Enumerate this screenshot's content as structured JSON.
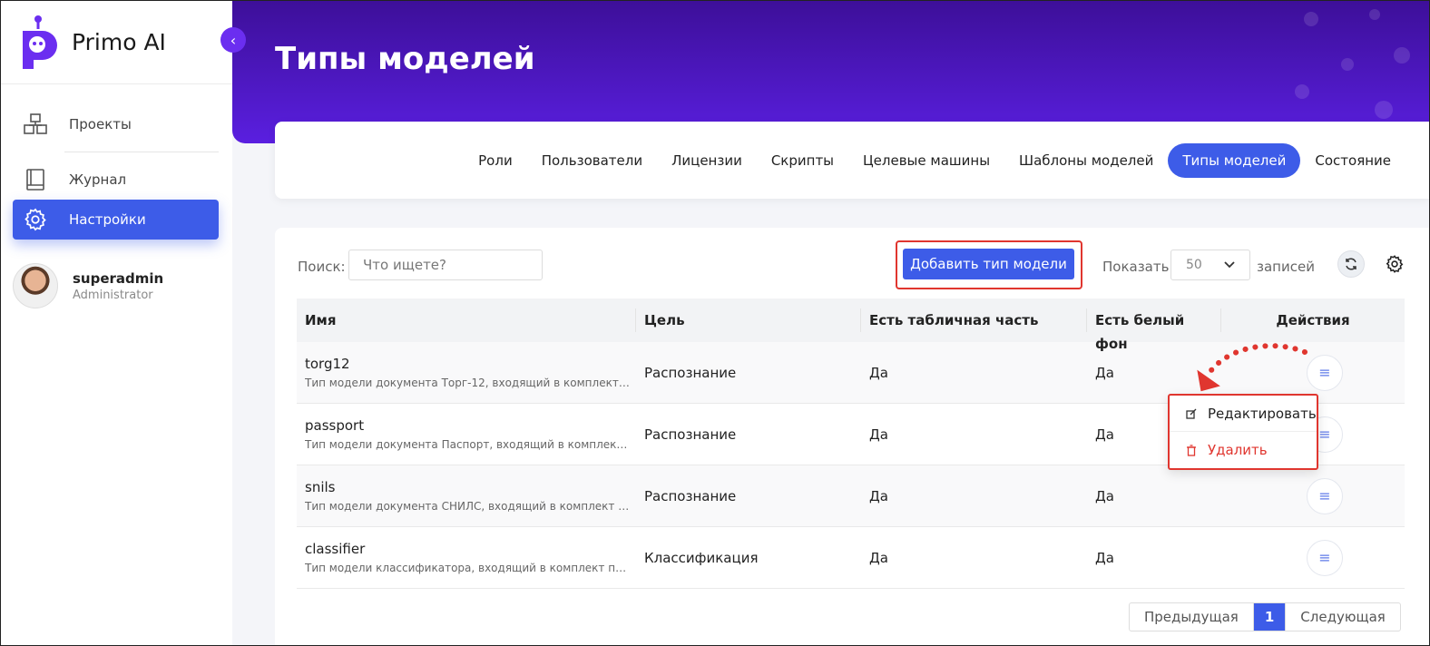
{
  "app": {
    "name": "Primo AI"
  },
  "header": {
    "title": "Типы моделей"
  },
  "sidebar": {
    "items": [
      {
        "label": "Проекты",
        "icon": "projects-icon"
      },
      {
        "label": "Журнал",
        "icon": "journal-icon"
      },
      {
        "label": "Настройки",
        "icon": "settings-icon",
        "active": true
      }
    ],
    "user": {
      "name": "superadmin",
      "role": "Administrator"
    }
  },
  "tabs": [
    "Роли",
    "Пользователи",
    "Лицензии",
    "Скрипты",
    "Целевые машины",
    "Шаблоны моделей",
    "Типы моделей",
    "Состояние"
  ],
  "active_tab": "Типы моделей",
  "toolbar": {
    "search_label": "Поиск:",
    "search_placeholder": "Что ищете?",
    "add_button": "Добавить тип модели",
    "show_label": "Показать",
    "page_size": "50",
    "records_label": "записей"
  },
  "table": {
    "columns": [
      "Имя",
      "Цель",
      "Есть табличная часть",
      "Есть белый фон",
      "Действия"
    ],
    "rows": [
      {
        "name": "torg12",
        "description": "Тип модели документа Торг-12, входящий в комплект пост…",
        "goal": "Распознание",
        "has_table": "Да",
        "white_bg": "Да"
      },
      {
        "name": "passport",
        "description": "Тип модели документа Паспорт, входящий в комплект пос…",
        "goal": "Распознание",
        "has_table": "Да",
        "white_bg": "Да"
      },
      {
        "name": "snils",
        "description": "Тип модели документа СНИЛС, входящий в комплект пост…",
        "goal": "Распознание",
        "has_table": "Да",
        "white_bg": "Да"
      },
      {
        "name": "classifier",
        "description": "Тип модели классификатора, входящий в комплект постав…",
        "goal": "Классификация",
        "has_table": "Да",
        "white_bg": "Да"
      }
    ]
  },
  "dropdown": {
    "edit": "Редактировать",
    "delete": "Удалить"
  },
  "pagination": {
    "prev": "Предыдущая",
    "current": "1",
    "next": "Следующая"
  },
  "colors": {
    "accent": "#3d5ce8",
    "header_top": "#3d0f99",
    "header_bottom": "#5a1fe0",
    "highlight": "#e0362f"
  }
}
